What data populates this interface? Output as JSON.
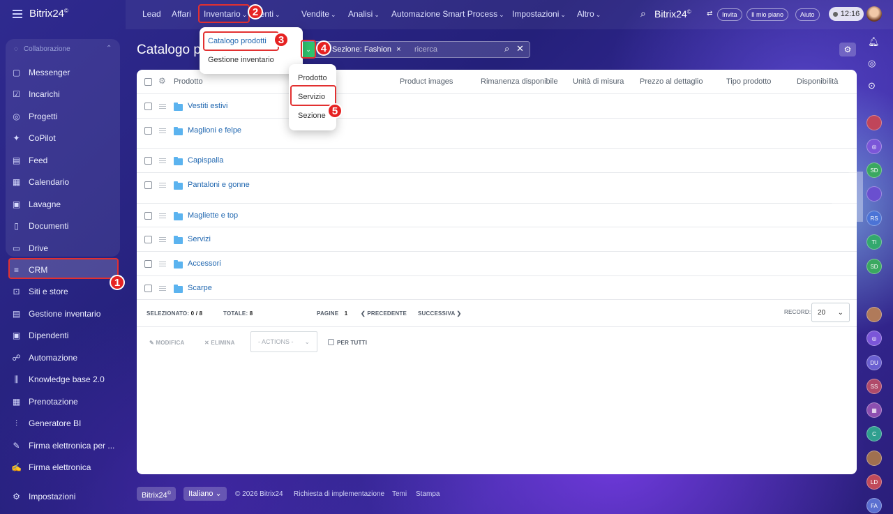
{
  "app": {
    "brand": "Bitrix24",
    "brand_mark": "©"
  },
  "sidebar": {
    "section_title": "Collaborazione",
    "items": [
      {
        "label": "Messenger",
        "icon": "messenger-icon",
        "glyph": "▢"
      },
      {
        "label": "Incarichi",
        "icon": "tasks-icon",
        "glyph": "☑"
      },
      {
        "label": "Progetti",
        "icon": "projects-icon",
        "glyph": "◎"
      },
      {
        "label": "CoPilot",
        "icon": "copilot-icon",
        "glyph": "✦"
      },
      {
        "label": "Feed",
        "icon": "feed-icon",
        "glyph": "▤"
      },
      {
        "label": "Calendario",
        "icon": "calendar-icon",
        "glyph": "▦"
      },
      {
        "label": "Lavagne",
        "icon": "boards-icon",
        "glyph": "▣"
      },
      {
        "label": "Documenti",
        "icon": "documents-icon",
        "glyph": "▯"
      },
      {
        "label": "Drive",
        "icon": "drive-icon",
        "glyph": "▭"
      },
      {
        "label": "CRM",
        "icon": "crm-icon",
        "glyph": "≡"
      },
      {
        "label": "Siti e store",
        "icon": "cart-icon",
        "glyph": "⊡"
      },
      {
        "label": "Gestione inventario",
        "icon": "inventory-icon",
        "glyph": "▤"
      },
      {
        "label": "Dipendenti",
        "icon": "employees-icon",
        "glyph": "▣"
      },
      {
        "label": "Automazione",
        "icon": "automation-icon",
        "glyph": "☍"
      },
      {
        "label": "Knowledge base 2.0",
        "icon": "knowledge-icon",
        "glyph": "⫼"
      },
      {
        "label": "Prenotazione",
        "icon": "booking-icon",
        "glyph": "▦"
      },
      {
        "label": "Generatore BI",
        "icon": "bi-icon",
        "glyph": "⫶"
      },
      {
        "label": "Firma elettronica per ...",
        "icon": "esign-hr-icon",
        "glyph": "✎"
      },
      {
        "label": "Firma elettronica",
        "icon": "esign-icon",
        "glyph": "✍"
      }
    ],
    "settings_label": "Impostazioni"
  },
  "topnav": {
    "items": [
      "Lead",
      "Affari",
      "Inventario",
      "Clienti",
      "Vendite",
      "Analisi",
      "Automazione Smart Process",
      "Impostazioni",
      "Altro"
    ],
    "clienti_visible": "ienti",
    "invite": "Invita",
    "my_plan": "Il mio piano",
    "help": "Aiuto",
    "time": "12:16"
  },
  "page": {
    "title": "Catalogo p",
    "filter_chip": "Sezione: Fashion",
    "search_placeholder": "ricerca"
  },
  "inventory_menu": {
    "items": [
      "Catalogo prodotti",
      "Gestione inventario"
    ]
  },
  "add_menu": {
    "items": [
      "Prodotto",
      "Servizio",
      "Sezione"
    ]
  },
  "grid": {
    "headers": [
      "Prodotto",
      "Product images",
      "Rimanenza disponibile",
      "Unità di misura",
      "Prezzo al dettaglio",
      "Tipo prodotto",
      "Disponibilità"
    ],
    "rows": [
      "Vestiti estivi",
      "Maglioni e felpe",
      "Capispalla",
      "Pantaloni e gonne",
      "Magliette e top",
      "Servizi",
      "Accessori",
      "Scarpe"
    ],
    "footer": {
      "selected_label": "SELEZIONATO:",
      "selected_value": "0 / 8",
      "total_label": "TOTALE:",
      "total_value": "8",
      "pages_label": "PAGINE",
      "page": "1",
      "prev": "PRECEDENTE",
      "next": "SUCCESSIVA",
      "record_label": "RECORD:",
      "record_value": "20"
    },
    "actions": {
      "edit": "MODIFICA",
      "delete": "ELIMINA",
      "select": "- ACTIONS -",
      "for_all": "PER TUTTI"
    }
  },
  "right_strip": [
    {
      "text": "",
      "bg": "#c0455a"
    },
    {
      "text": "◎",
      "bg": "#7b56d8"
    },
    {
      "text": "SD",
      "bg": "#3aa860"
    },
    {
      "text": "",
      "bg": "#6a4fcf"
    },
    {
      "text": "RS",
      "bg": "#4b73d6"
    },
    {
      "text": "TI",
      "bg": "#33a86e"
    },
    {
      "text": "SD",
      "bg": "#3aa860"
    },
    {
      "text": "",
      "bg": "#b07a5a"
    },
    {
      "text": "◎",
      "bg": "#7b56d8"
    },
    {
      "text": "DU",
      "bg": "#6a5fd0"
    },
    {
      "text": "SS",
      "bg": "#b04a6a"
    },
    {
      "text": "▦",
      "bg": "#8d4fb0"
    },
    {
      "text": "C",
      "bg": "#2f9f8f"
    },
    {
      "text": "",
      "bg": "#a07050"
    },
    {
      "text": "LD",
      "bg": "#c04a5a"
    },
    {
      "text": "FA",
      "bg": "#5a6fd0"
    }
  ],
  "footer": {
    "brand": "Bitrix24",
    "language": "Italiano",
    "copyright": "© 2026 Bitrix24",
    "links": [
      "Richiesta di implementazione",
      "Temi",
      "Stampa"
    ]
  },
  "annotations": [
    "1",
    "2",
    "3",
    "4",
    "5"
  ],
  "colors": {
    "accent_red": "#e23030",
    "link_blue": "#2067b0",
    "folder_blue": "#5bb3ef",
    "green": "#2fc36e"
  }
}
